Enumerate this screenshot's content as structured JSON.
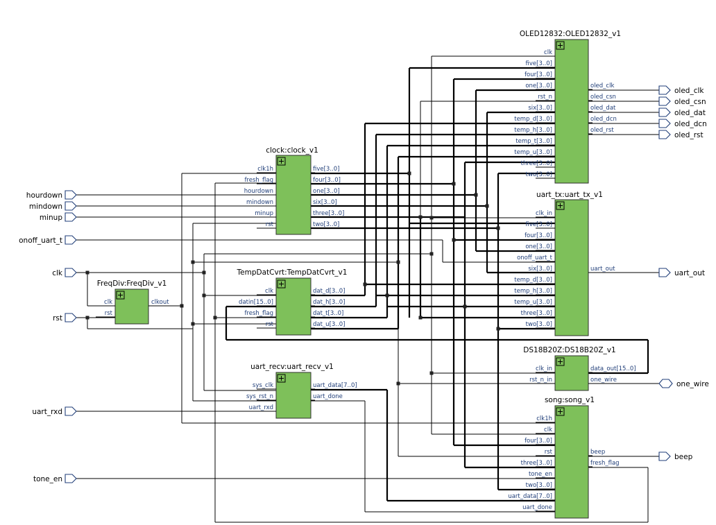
{
  "diagram": {
    "type": "rtl-netlist-schematic",
    "inputs": [
      "hourdown",
      "mindown",
      "minup",
      "onoff_uart_t",
      "clk",
      "rst",
      "uart_rxd",
      "tone_en"
    ],
    "outputs": [
      "oled_clk",
      "oled_csn",
      "oled_dat",
      "oled_dcn",
      "oled_rst",
      "uart_out",
      "beep"
    ],
    "inouts": [
      "one_wire"
    ],
    "blocks": {
      "oled": {
        "title": "OLED12832:OLED12832_v1",
        "left_pins": [
          "clk",
          "five[3..0]",
          "four[3..0]",
          "one[3..0]",
          "rst_n",
          "six[3..0]",
          "temp_d[3..0]",
          "temp_h[3..0]",
          "temp_t[3..0]",
          "temp_u[3..0]",
          "three[3..0]",
          "two[3..0]"
        ],
        "right_pins": [
          "oled_clk",
          "oled_csn",
          "oled_dat",
          "oled_dcn",
          "oled_rst"
        ]
      },
      "clock": {
        "title": "clock:clock_v1",
        "left_pins": [
          "clk1h",
          "fresh_flag",
          "hourdown",
          "mindown",
          "minup",
          "rst"
        ],
        "right_pins": [
          "five[3..0]",
          "four[3..0]",
          "one[3..0]",
          "six[3..0]",
          "three[3..0]",
          "two[3..0]"
        ]
      },
      "uart_tx": {
        "title": "uart_tx:uart_tx_v1",
        "left_pins": [
          "clk_in",
          "five[3..0]",
          "four[3..0]",
          "one[3..0]",
          "onoff_uart_t",
          "six[3..0]",
          "temp_d[3..0]",
          "temp_h[3..0]",
          "temp_u[3..0]",
          "three[3..0]",
          "two[3..0]"
        ],
        "right_pins": [
          "uart_out"
        ]
      },
      "freqdiv": {
        "title": "FreqDiv:FreqDiv_v1",
        "left_pins": [
          "clk",
          "rst"
        ],
        "right_pins": [
          "clkout"
        ]
      },
      "tempdat": {
        "title": "TempDatCvrt:TempDatCvrt_v1",
        "left_pins": [
          "clk",
          "datin[15..0]",
          "fresh_flag",
          "rst"
        ],
        "right_pins": [
          "dat_d[3..0]",
          "dat_h[3..0]",
          "dat_t[3..0]",
          "dat_u[3..0]"
        ]
      },
      "ds18": {
        "title": "DS18B20Z:DS18B20Z_v1",
        "left_pins": [
          "clk_in",
          "rst_n_in"
        ],
        "right_pins": [
          "data_out[15..0]",
          "one_wire"
        ]
      },
      "uart_recv": {
        "title": "uart_recv:uart_recv_v1",
        "left_pins": [
          "sys_clk",
          "sys_rst_n",
          "uart_rxd"
        ],
        "right_pins": [
          "uart_data[7..0]",
          "uart_done"
        ]
      },
      "song": {
        "title": "song:song_v1",
        "left_pins": [
          "clk1h",
          "clk",
          "four[3..0]",
          "rst",
          "three[3..0]",
          "tone_en",
          "two[3..0]",
          "uart_data[7..0]",
          "uart_done"
        ],
        "right_pins": [
          "beep",
          "fresh_flag"
        ]
      }
    }
  }
}
